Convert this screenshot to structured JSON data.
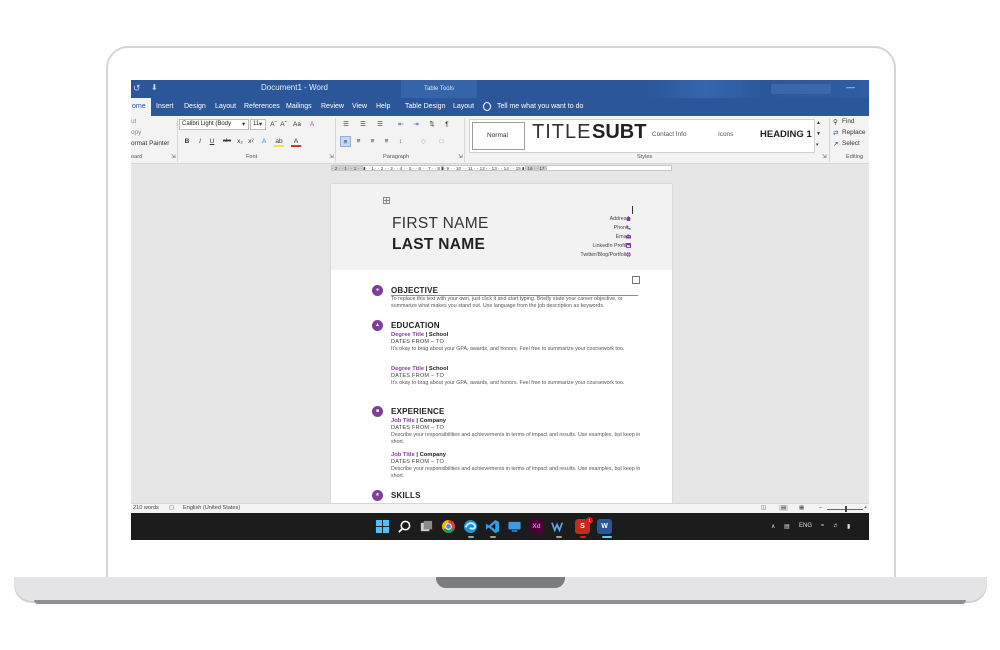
{
  "window": {
    "title": "Document1  -  Word",
    "context_tab_group": "Table Tools",
    "undo_glyph": "↺",
    "qat_more_glyph": "⬇",
    "minimize_glyph": "—"
  },
  "tabs": {
    "home": "ome",
    "insert": "Insert",
    "design": "Design",
    "layout": "Layout",
    "references": "References",
    "mailings": "Mailings",
    "review": "Review",
    "view": "View",
    "help": "Help",
    "table_design": "Table Design",
    "table_layout": "Layout",
    "tell_me": "Tell me what you want to do"
  },
  "clipboard": {
    "cut": "ut",
    "copy": "opy",
    "format_painter": "ormat Painter",
    "group_label": "oard"
  },
  "font": {
    "font_name": "Calibri Light (Body",
    "font_size": "11",
    "grow": "Aˆ",
    "shrink": "Aˇ",
    "change_case": "Aa",
    "clear_formatting": "A",
    "bold": "B",
    "italic": "I",
    "underline": "U",
    "strikethrough": "abc",
    "subscript": "x₂",
    "superscript": "x²",
    "text_effects": "A",
    "highlight": "ab",
    "font_color": "A",
    "group_label": "Font"
  },
  "paragraph": {
    "bullets": "☰",
    "numbering": "☰",
    "multilevel": "☰",
    "decrease_indent": "⇤",
    "increase_indent": "⇥",
    "sort": "⇅",
    "show_marks": "¶",
    "align_left": "≡",
    "center": "≡",
    "align_right": "≡",
    "justify": "≡",
    "line_spacing": "↕",
    "shading": "◇",
    "borders": "□",
    "group_label": "Paragraph"
  },
  "styles": {
    "normal": "Normal",
    "title": "TITLE",
    "subtitle": "SUBT",
    "contact_info": "Contact Info",
    "icons": "Icons",
    "heading1": "HEADING 1",
    "group_label": "Styles"
  },
  "editing": {
    "find": "Find",
    "replace": "Replace",
    "select": "Select",
    "group_label": "Editing"
  },
  "ruler": {
    "left": "· 2 · · 1 · · 1 · · ",
    "main": "· · 1 · · 2 · · 3 · · 4 · · 5 · · 6 · · 7 · · 8 ",
    "mid": "· 9 · · 10 · · 11 · · 12 · · 13 · · 14 · · 15 ",
    "right": "· 16 · · 17 ·"
  },
  "document": {
    "first_name": "FIRST NAME",
    "last_name": "LAST NAME",
    "contact": {
      "address": "Address",
      "phone": "Phone",
      "email": "Email",
      "linkedin": "LinkedIn Profile",
      "twitter": "Twitter/Blog/Portfolio"
    },
    "sections": {
      "objective": {
        "title": "OBJECTIVE",
        "text": "To replace this text with your own, just click it and start typing. Briefly state your career objective, or summarize what makes you stand out. Use language from the job description as keywords."
      },
      "education": {
        "title": "EDUCATION",
        "entries": [
          {
            "title": "Degree Title",
            "separator": " | ",
            "org": "School",
            "dates": "DATES FROM – TO",
            "text": "It’s okay to brag about your GPA, awards, and honors. Feel free to summarize your coursework too."
          },
          {
            "title": "Degree Title",
            "separator": " | ",
            "org": "School",
            "dates": "DATES FROM – TO",
            "text": "It’s okay to brag about your GPA, awards, and honors. Feel free to summarize your coursework too."
          }
        ]
      },
      "experience": {
        "title": "EXPERIENCE",
        "entries": [
          {
            "title": "Job Title",
            "separator": " | ",
            "org": "Company",
            "dates": "DATES FROM – TO",
            "text": "Describe your responsibilities and achievements in terms of impact and results. Use examples, but keep in short."
          },
          {
            "title": "Job Title",
            "separator": " | ",
            "org": "Company",
            "dates": "DATES FROM – TO",
            "text": "Describe your responsibilities and achievements in terms of impact and results. Use examples, but keep in short."
          }
        ]
      },
      "skills": {
        "title": "SKILLS"
      }
    }
  },
  "status": {
    "word_count": "210 words",
    "language": "English (United States)",
    "zoom_minus": "–",
    "zoom_plus": "+"
  },
  "taskbar": {
    "xd_label": "Xd",
    "skype_label": "S",
    "word_label": "W",
    "badge": "1"
  },
  "tray": {
    "chevron": "∧",
    "lang": "ENG"
  },
  "colors": {
    "word_blue": "#2b579a",
    "accent_purple": "#7e3f98",
    "taskbar": "#1c1c1c"
  }
}
